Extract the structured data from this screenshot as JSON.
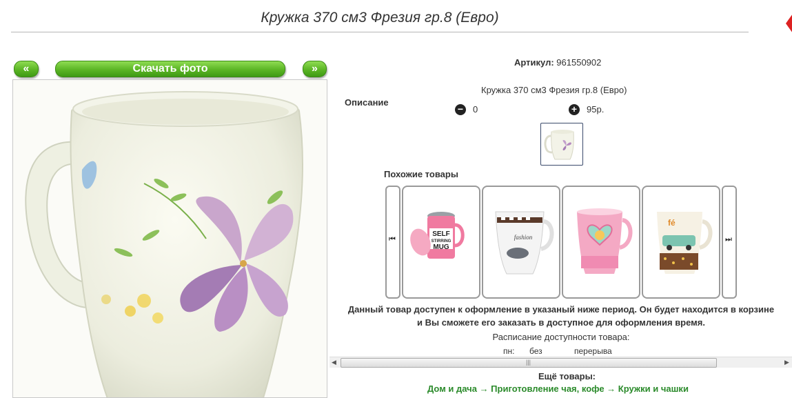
{
  "product": {
    "title": "Кружка 370 см3 Фрезия гр.8 (Евро)",
    "article_label": "Артикул:",
    "article_value": "961550902",
    "description_label": "Описание",
    "description_text": "Кружка 370 см3 Фрезия гр.8 (Евро)",
    "quantity": "0",
    "price": "95р."
  },
  "photo_nav": {
    "prev_label": "«",
    "download_label": "Скачать фото",
    "next_label": "»"
  },
  "similar": {
    "label": "Похожие товары",
    "items": [
      {
        "name": "self-stirring-mug"
      },
      {
        "name": "fashion-mug"
      },
      {
        "name": "pink-heart-mug"
      },
      {
        "name": "car-mug"
      }
    ]
  },
  "availability": {
    "notice": "Данный товар доступен к оформление в указаный ниже период. Он будет находится в корзине и Вы сможете его заказать в доступное для оформления время.",
    "schedule_title": "Расписание доступности товара:",
    "day": "пн:",
    "from": "без",
    "to": "перерыва"
  },
  "more": {
    "label": "Ещё товары:",
    "links": "Дом и дача → Приготовление чая, кофе → Кружки и чашки"
  },
  "colors": {
    "button_green": "#5bb525",
    "link_green": "#2a8a2a"
  }
}
